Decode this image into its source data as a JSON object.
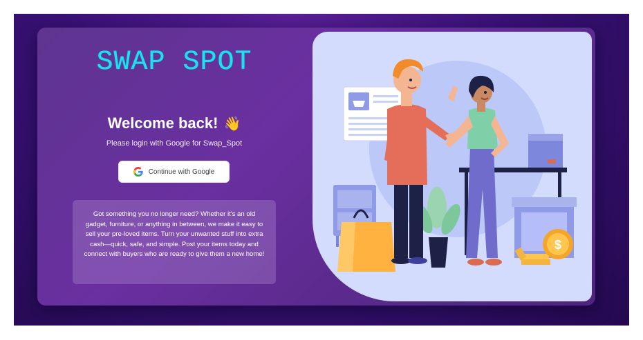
{
  "app": {
    "brand": "SWAP SPOT"
  },
  "login": {
    "heading": "Welcome back!",
    "wave_emoji": "👋",
    "subtitle": "Please login with Google for Swap_Spot",
    "google_button_label": "Continue with Google",
    "google_icon": "google-g-icon"
  },
  "info": {
    "text": "Got something you no longer need? Whether it's an old gadget, furniture, or anything in between, we make it easy to sell your pre-loved items. Turn your unwanted stuff into extra cash—quick, safe, and simple. Post your items today and connect with buyers who are ready to give them a new home!"
  },
  "colors": {
    "brand": "#19e3f0",
    "background_dark": "#24094f",
    "card": "#6a2fa0",
    "illustration_bg": "#d3dcfc"
  },
  "illustration": {
    "description_icons": [
      "shopping-basket-icon",
      "coin-icon",
      "dollar-sign-icon"
    ]
  }
}
